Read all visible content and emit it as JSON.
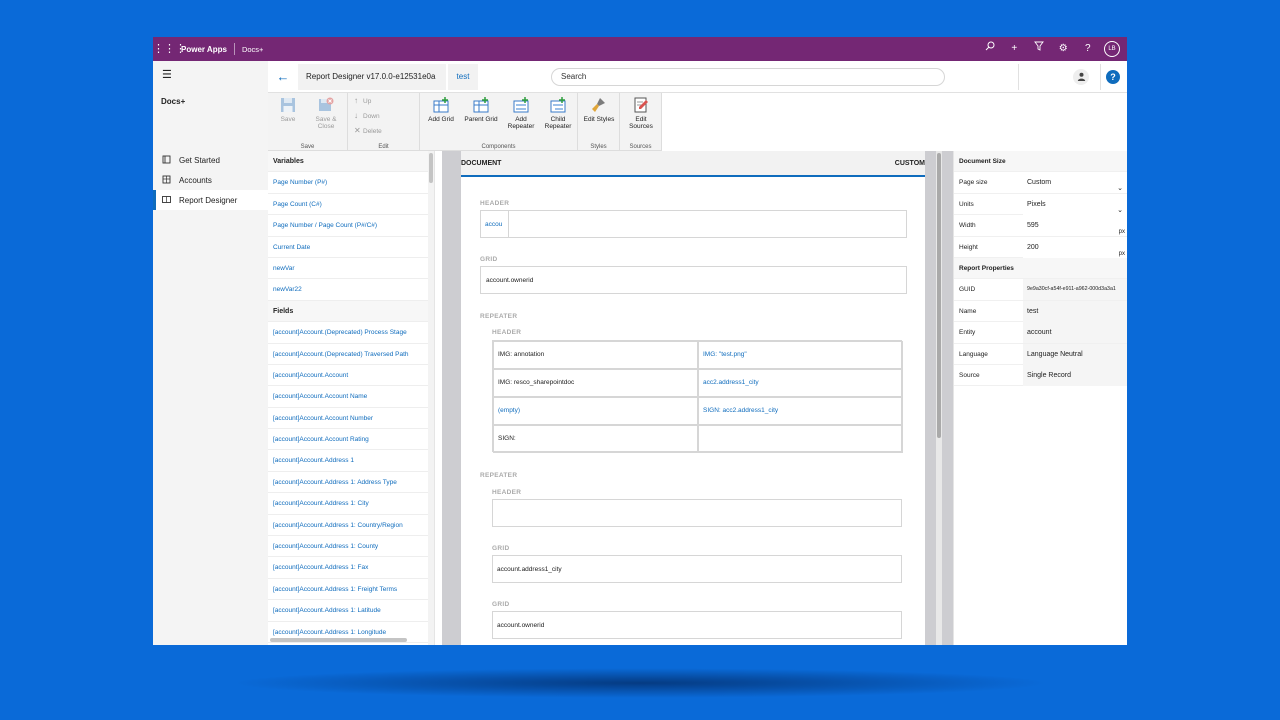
{
  "topbar": {
    "brand": "Power Apps",
    "app_name": "Docs+",
    "user_initials": "LB"
  },
  "nav": {
    "title": "Docs+",
    "items": [
      {
        "label": "Get Started",
        "icon": "book-icon"
      },
      {
        "label": "Accounts",
        "icon": "building-icon"
      },
      {
        "label": "Report Designer",
        "icon": "report-icon"
      }
    ]
  },
  "cmd": {
    "record_title": "Report Designer v17.0.0-e12531e0a",
    "record_name": "test",
    "search_placeholder": "Search"
  },
  "ribbon": {
    "save": "Save",
    "save_close_1": "Save &",
    "save_close_2": "Close",
    "group_save": "Save",
    "up": "Up",
    "down": "Down",
    "delete": "Delete",
    "group_edit": "Edit",
    "add_grid": "Add Grid",
    "parent_grid": "Parent Grid",
    "add_repeater_1": "Add",
    "add_repeater_2": "Repeater",
    "child_repeater_1": "Child",
    "child_repeater_2": "Repeater",
    "group_components": "Components",
    "edit_styles": "Edit Styles",
    "group_styles": "Styles",
    "edit_sources_1": "Edit",
    "edit_sources_2": "Sources",
    "group_sources": "Sources"
  },
  "panel": {
    "variables_header": "Variables",
    "variables": [
      "Page Number (P#)",
      "Page Count (C#)",
      "Page Number / Page Count (P#/C#)",
      "Current Date",
      "newVar",
      "newVar22"
    ],
    "fields_header": "Fields",
    "fields": [
      "[account]Account.(Deprecated) Process Stage",
      "[account]Account.(Deprecated) Traversed Path",
      "[account]Account.Account",
      "[account]Account.Account Name",
      "[account]Account.Account Number",
      "[account]Account.Account Rating",
      "[account]Account.Address 1",
      "[account]Account.Address 1: Address Type",
      "[account]Account.Address 1: City",
      "[account]Account.Address 1: Country/Region",
      "[account]Account.Address 1: County",
      "[account]Account.Address 1: Fax",
      "[account]Account.Address 1: Freight Terms",
      "[account]Account.Address 1: Latitude",
      "[account]Account.Address 1: Longitude"
    ]
  },
  "canvas": {
    "doc_label": "DOCUMENT",
    "custom_label": "CUSTOM",
    "header_label": "HEADER",
    "header_cell": "accou",
    "grid_label": "GRID",
    "grid_cell": "account.ownerid",
    "repeater_label": "REPEATER",
    "rep1_header_label": "HEADER",
    "rep1_cells": [
      "IMG: annotation",
      "IMG: \"test.png\"",
      "IMG: resco_sharepointdoc",
      "acc2.address1_city",
      "(empty)",
      "SIGN: acc2.address1_city",
      "SIGN:",
      ""
    ],
    "repeater2_label": "REPEATER",
    "rep2_header_label": "HEADER",
    "rep2_grid1_label": "GRID",
    "rep2_grid1_cell": "account.address1_city",
    "rep2_grid2_label": "GRID",
    "rep2_grid2_cell": "account.ownerid"
  },
  "props": {
    "doc_size_header": "Document Size",
    "page_size_label": "Page size",
    "page_size_value": "Custom",
    "units_label": "Units",
    "units_value": "Pixels",
    "width_label": "Width",
    "width_value": "595",
    "height_label": "Height",
    "height_value": "200",
    "px_unit": "px",
    "report_props_header": "Report Properties",
    "guid_label": "GUID",
    "guid_value": "9e9a30cf-a54f-e911-a962-000d3a3a1",
    "name_label": "Name",
    "name_value": "test",
    "entity_label": "Entity",
    "entity_value": "account",
    "language_label": "Language",
    "language_value": "Language Neutral",
    "source_label": "Source",
    "source_value": "Single Record"
  },
  "colors": {
    "topbar": "#742774",
    "accent": "#0f6cbd",
    "background": "#0a6ad8"
  }
}
